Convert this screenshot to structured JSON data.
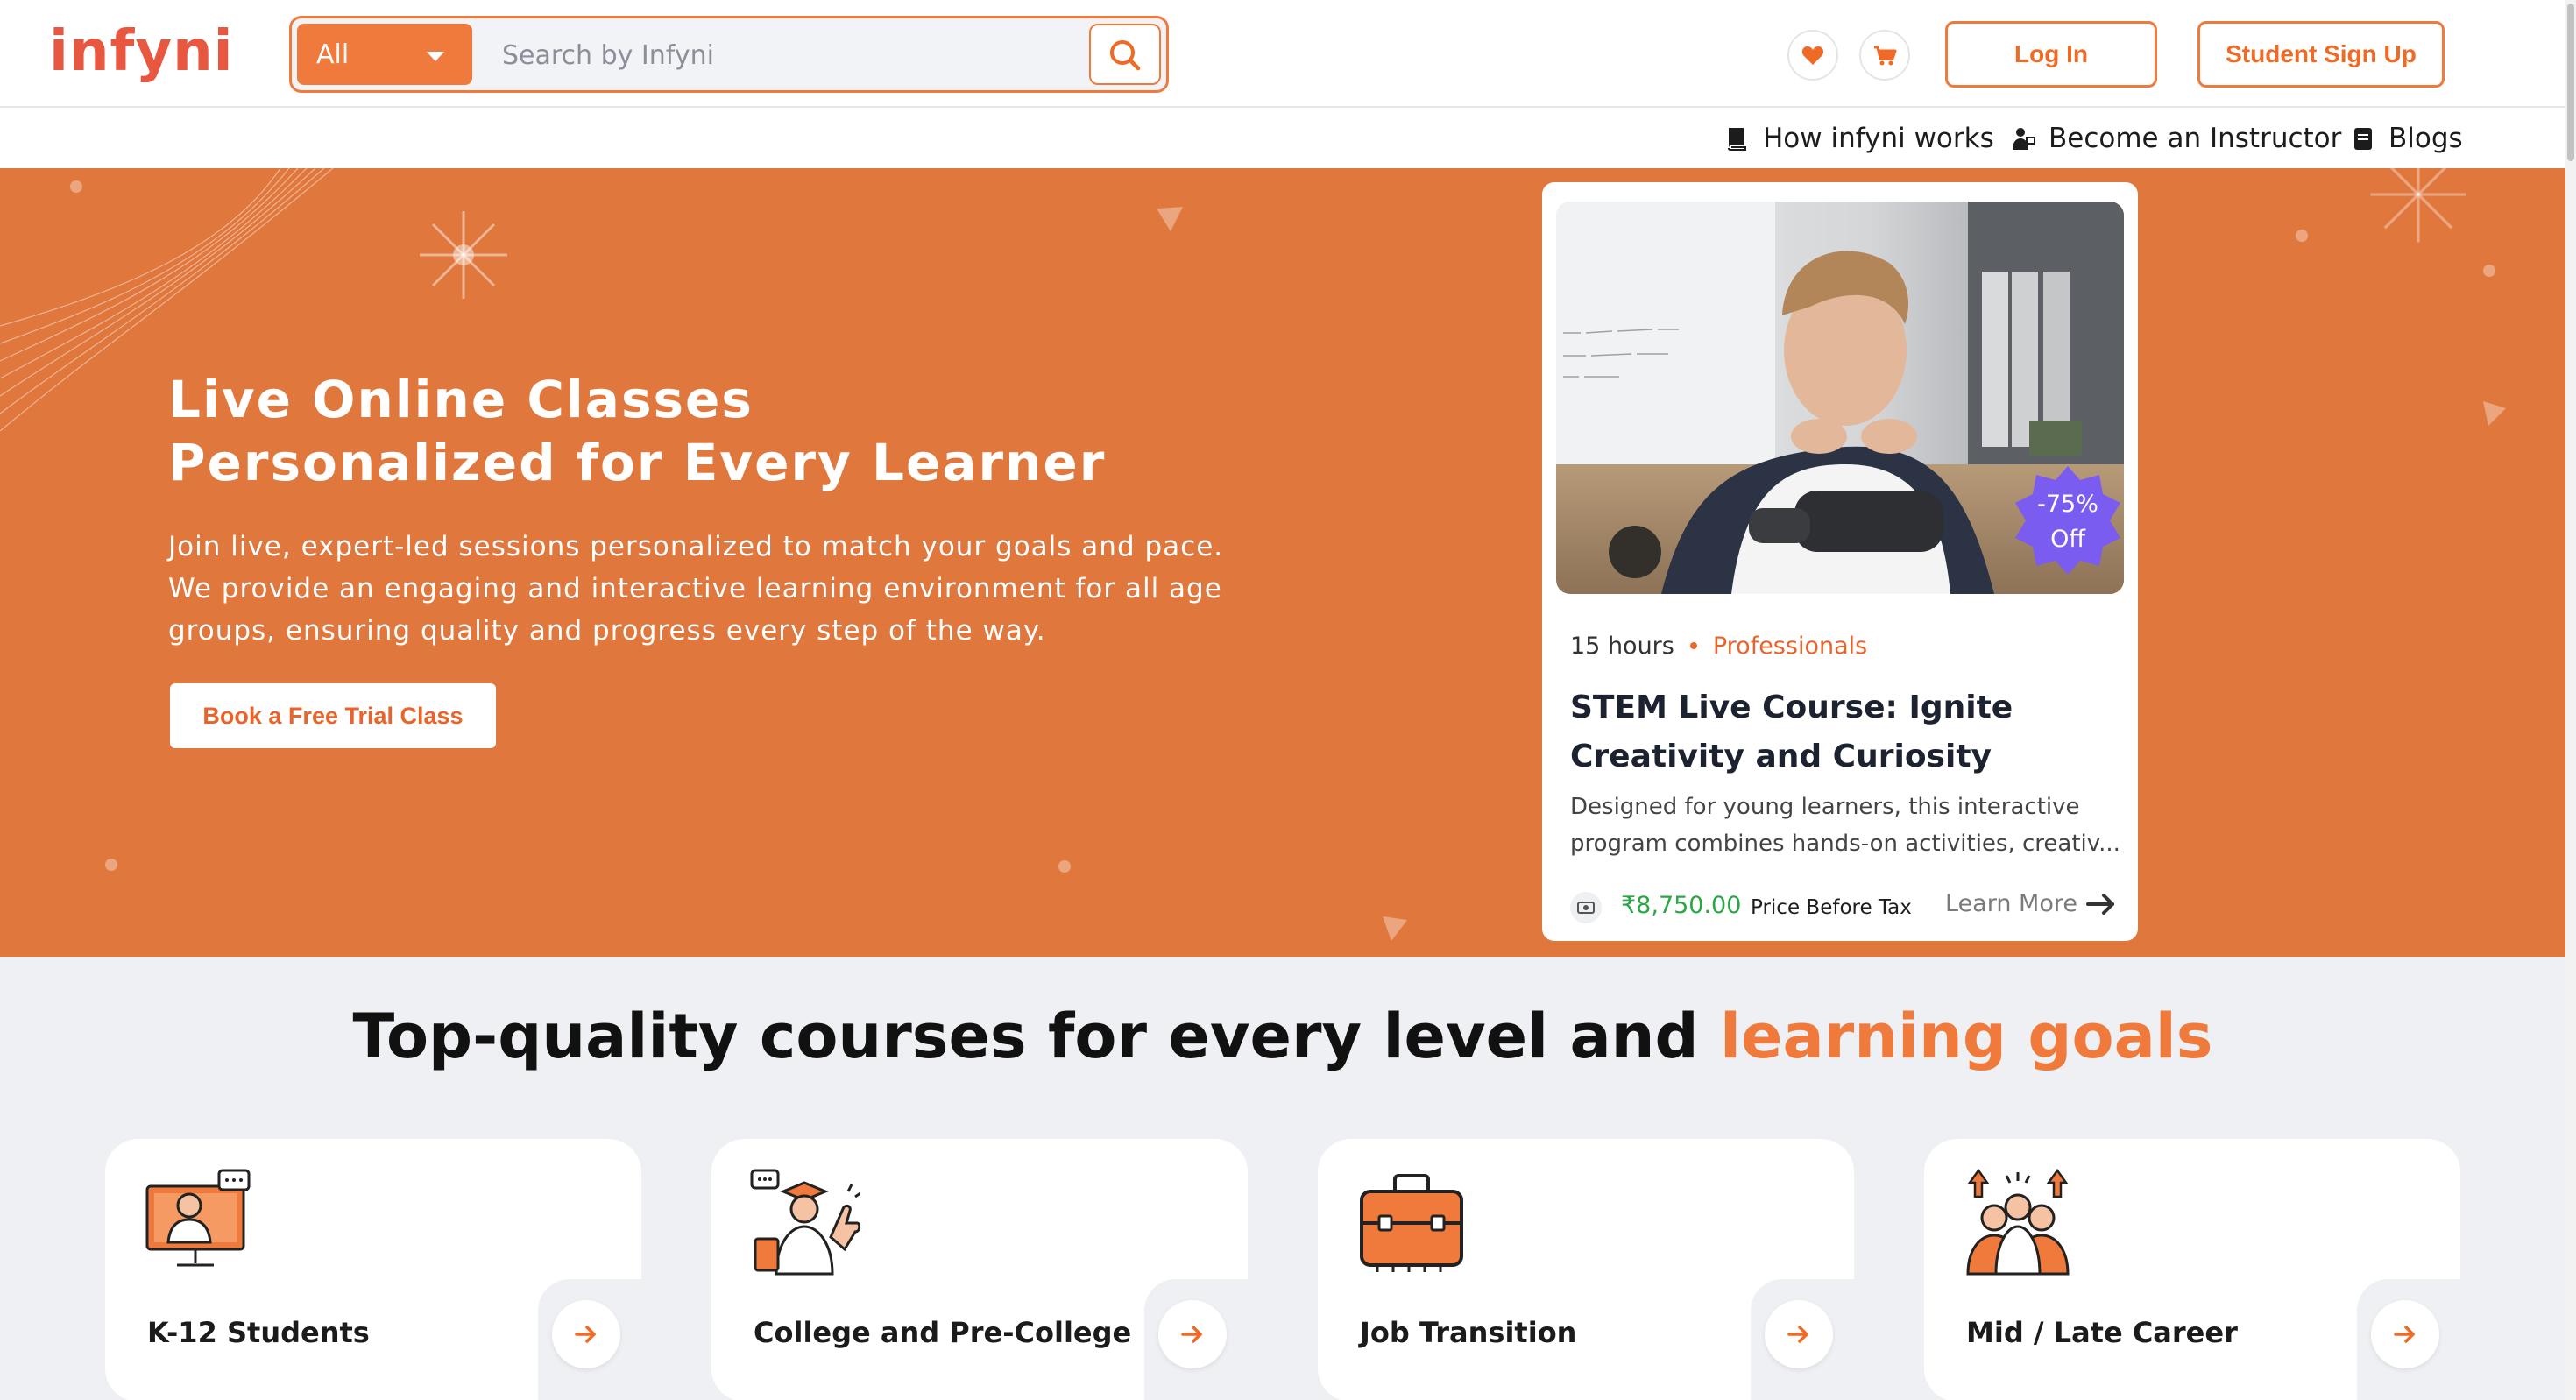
{
  "header": {
    "logo": "infyni",
    "search": {
      "category": "All",
      "placeholder": "Search by Infyni",
      "icon": "search-icon"
    },
    "wishlist_icon": "heart-icon",
    "cart_icon": "cart-icon",
    "login_label": "Log In",
    "signup_label": "Student Sign Up"
  },
  "subnav": {
    "items": [
      {
        "label": "How infyni works",
        "icon": "book-icon"
      },
      {
        "label": "Become an Instructor",
        "icon": "instructor-icon"
      },
      {
        "label": "Blogs",
        "icon": "blog-icon"
      }
    ]
  },
  "hero": {
    "title_line1": "Live Online Classes",
    "title_line2": "Personalized for Every Learner",
    "description": "Join live, expert-led sessions personalized to match your goals and pace. We provide an engaging and interactive learning environment for all age groups, ensuring quality and progress every step of the way.",
    "cta_label": "Book a Free Trial Class"
  },
  "course": {
    "discount": "-75%",
    "discount_suffix": "Off",
    "duration": "15 hours",
    "level": "Professionals",
    "title": "STEM Live Course: Ignite Creativity and Curiosity",
    "description": "Designed for young learners, this interactive program combines hands-on activities, creativ...",
    "price": "₹8,750.00",
    "price_note": "Price Before Tax",
    "learn_more": "Learn More"
  },
  "categories": {
    "heading_main": "Top-quality courses for every level and ",
    "heading_highlight": "learning goals",
    "items": [
      {
        "label": "K-12 Students",
        "icon": "student-at-screen-icon"
      },
      {
        "label": "College and Pre-College",
        "icon": "graduate-thumbs-up-icon"
      },
      {
        "label": "Job Transition",
        "icon": "briefcase-icon"
      },
      {
        "label": "Mid / Late Career",
        "icon": "career-growth-icon"
      }
    ]
  },
  "colors": {
    "brand": "#ef7a3b",
    "hero_bg": "#e0773d",
    "logo": "#e8573f",
    "price": "#28a745",
    "badge": "#7b5cf0"
  }
}
